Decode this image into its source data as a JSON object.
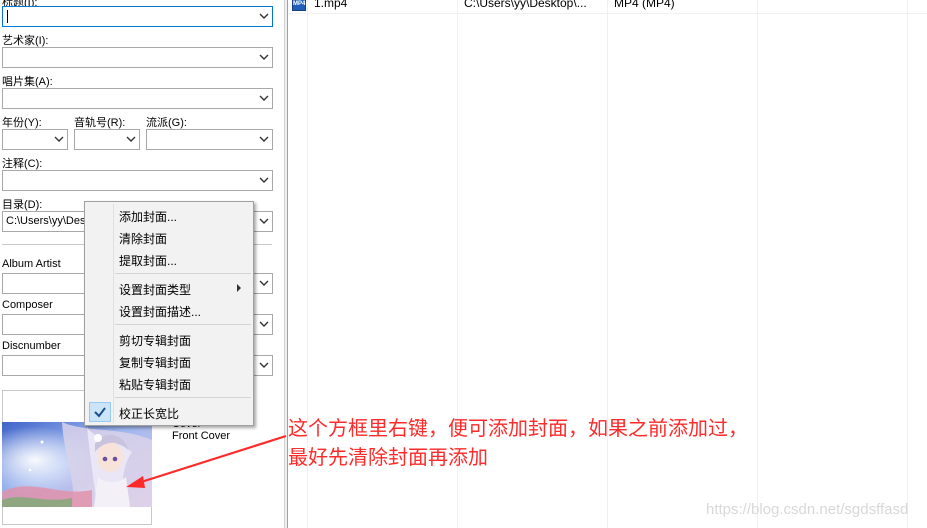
{
  "tag_panel": {
    "title_label": "标题(I):",
    "artist_label": "艺术家(I):",
    "album_label": "唱片集(A):",
    "year_label": "年份(Y):",
    "track_label": "音轨号(R):",
    "genre_label": "流派(G):",
    "comment_label": "注释(C):",
    "directory_label": "目录(D):",
    "directory_value": "C:\\Users\\yy\\Des",
    "album_artist_label": "Album Artist",
    "composer_label": "Composer",
    "discnumber_label": "Discnumber"
  },
  "cover": {
    "type_text": "Front Cover",
    "partial_text": "Cover"
  },
  "file_list": {
    "row": {
      "icon_text": "MP4",
      "filename": "1.mp4",
      "path": "C:\\Users\\yy\\Desktop\\...",
      "type": "MP4 (MP4)"
    }
  },
  "context_menu": {
    "items": [
      {
        "label": "添加封面..."
      },
      {
        "label": "清除封面"
      },
      {
        "label": "提取封面..."
      },
      {
        "label": "设置封面类型"
      },
      {
        "label": "设置封面描述..."
      },
      {
        "label": "剪切专辑封面"
      },
      {
        "label": "复制专辑封面"
      },
      {
        "label": "粘贴专辑封面"
      },
      {
        "label": "校正长宽比"
      }
    ]
  },
  "annotation": {
    "line1": "这个方框里右键，便可添加封面，如果之前添加过，",
    "line2": "最好先清除封面再添加"
  },
  "watermark": "https://blog.csdn.net/sgdsffasd",
  "colors": {
    "annotation_red": "#ff2a2a",
    "focus_blue": "#0078d7",
    "check_highlight": "#cce4f7"
  },
  "icons": [
    "dropdown-arrow-icon",
    "submenu-arrow-icon",
    "checkmark-icon",
    "mp4-file-icon"
  ]
}
